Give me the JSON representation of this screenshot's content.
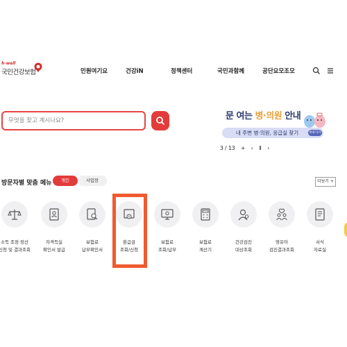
{
  "header": {
    "logo_tag": "h-well",
    "logo_text": "국민건강보험",
    "nav": [
      "민원여기요",
      "건강iN",
      "정책센터",
      "국민과함께",
      "공단요모조모"
    ],
    "icons": [
      "search-icon",
      "menu-icon"
    ]
  },
  "search": {
    "placeholder": "무엇을 찾고 계시나요?"
  },
  "banner": {
    "title_a": "문 여는 ",
    "title_b": "병·의원",
    "title_c": " 안내",
    "subtitle": "내 주변 병·의원, 응급실 찾기",
    "button": "바로가기",
    "pager_index": "3 / 13",
    "pager_plus": "+",
    "pager_prev": "‹",
    "pager_pause": "Ⅱ",
    "pager_next": "›"
  },
  "visitor_menu": {
    "title": "방문자별 맞춤 메뉴",
    "tab_personal": "개인",
    "tab_business": "사업장",
    "more": "더보기 +",
    "items": [
      {
        "label": "소득 조정·정산\n신청 및 결과조회",
        "icon": "scale-icon"
      },
      {
        "label": "자격득실\n확인서 발급",
        "icon": "id-card-icon"
      },
      {
        "label": "보험료\n납부확인서",
        "icon": "document-search-icon"
      },
      {
        "label": "환급금\n조회/신청",
        "icon": "refund-icon"
      },
      {
        "label": "보험료\n조회/납부",
        "icon": "monitor-icon"
      },
      {
        "label": "보험료\n계산기",
        "icon": "calculator-icon"
      },
      {
        "label": "건강검진\n대상조회",
        "icon": "person-search-icon"
      },
      {
        "label": "영유아\n검진결과조회",
        "icon": "children-icon"
      },
      {
        "label": "서식\n자료실",
        "icon": "form-document-icon"
      }
    ]
  },
  "colors": {
    "accent": "#e33b3b",
    "highlight": "#f05a2e",
    "banner_navy": "#2b3a6b"
  }
}
